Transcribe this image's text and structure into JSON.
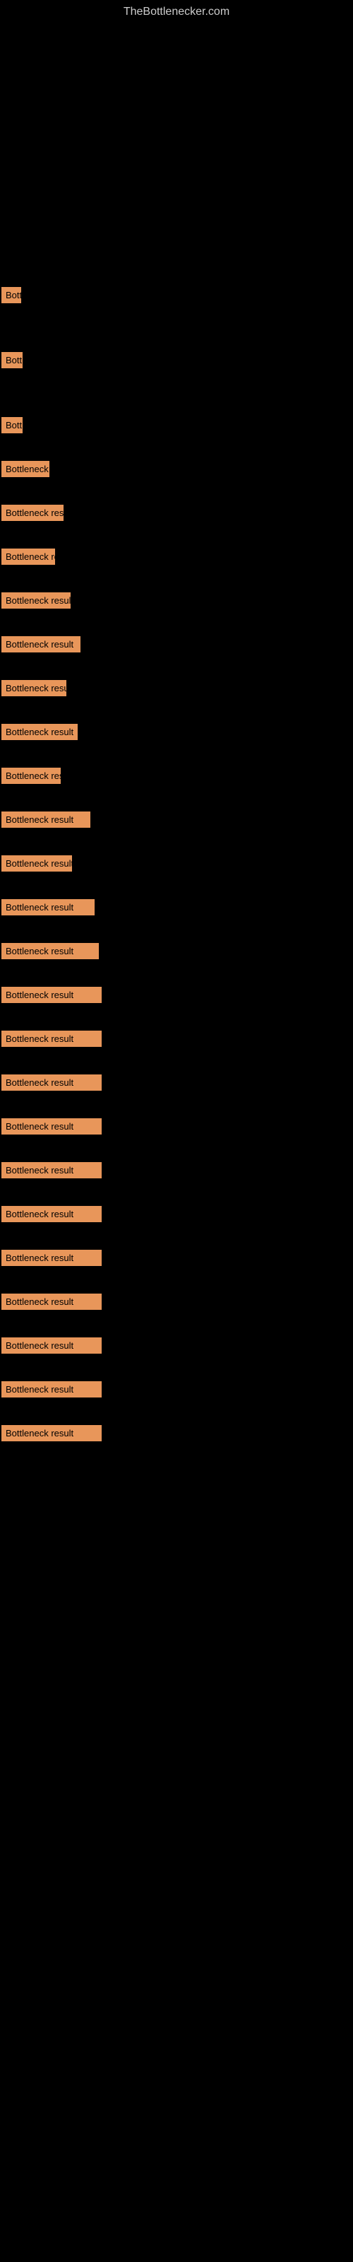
{
  "site": {
    "title": "TheBottlenecker.com"
  },
  "results": [
    {
      "id": 1,
      "label": "Bottleneck result",
      "width_class": "w-tiny",
      "gap_before": 380
    },
    {
      "id": 2,
      "label": "Bottleneck result",
      "width_class": "w-tiny",
      "gap_before": 60
    },
    {
      "id": 3,
      "label": "Bottleneck result",
      "width_class": "w-tiny",
      "gap_before": 60
    },
    {
      "id": 4,
      "label": "Bottleneck result",
      "width_class": "w-small",
      "gap_before": 30
    },
    {
      "id": 5,
      "label": "Bottleneck result",
      "width_class": "w-small",
      "gap_before": 30
    },
    {
      "id": 6,
      "label": "Bottleneck result",
      "width_class": "w-small2",
      "gap_before": 30
    },
    {
      "id": 7,
      "label": "Bottleneck result",
      "width_class": "w-med1",
      "gap_before": 30
    },
    {
      "id": 8,
      "label": "Bottleneck result",
      "width_class": "w-med2",
      "gap_before": 30
    },
    {
      "id": 9,
      "label": "Bottleneck result",
      "width_class": "w-med3",
      "gap_before": 30
    },
    {
      "id": 10,
      "label": "Bottleneck result",
      "width_class": "w-med4",
      "gap_before": 30
    },
    {
      "id": 11,
      "label": "Bottleneck result",
      "width_class": "w-med5",
      "gap_before": 30
    },
    {
      "id": 12,
      "label": "Bottleneck result",
      "width_class": "w-med6",
      "gap_before": 30
    },
    {
      "id": 13,
      "label": "Bottleneck result",
      "width_class": "w-med7",
      "gap_before": 30
    },
    {
      "id": 14,
      "label": "Bottleneck result",
      "width_class": "w-med8",
      "gap_before": 30
    },
    {
      "id": 15,
      "label": "Bottleneck result",
      "width_class": "w-full",
      "gap_before": 30
    },
    {
      "id": 16,
      "label": "Bottleneck result",
      "width_class": "w-full2",
      "gap_before": 30
    },
    {
      "id": 17,
      "label": "Bottleneck result",
      "width_class": "w-full",
      "gap_before": 30
    },
    {
      "id": 18,
      "label": "Bottleneck result",
      "width_class": "w-full",
      "gap_before": 30
    },
    {
      "id": 19,
      "label": "Bottleneck result",
      "width_class": "w-full",
      "gap_before": 30
    },
    {
      "id": 20,
      "label": "Bottleneck result",
      "width_class": "w-full",
      "gap_before": 30
    },
    {
      "id": 21,
      "label": "Bottleneck result",
      "width_class": "w-full",
      "gap_before": 30
    },
    {
      "id": 22,
      "label": "Bottleneck result",
      "width_class": "w-full",
      "gap_before": 30
    },
    {
      "id": 23,
      "label": "Bottleneck result",
      "width_class": "w-full",
      "gap_before": 30
    },
    {
      "id": 24,
      "label": "Bottleneck result",
      "width_class": "w-full",
      "gap_before": 30
    },
    {
      "id": 25,
      "label": "Bottleneck result",
      "width_class": "w-full",
      "gap_before": 30
    },
    {
      "id": 26,
      "label": "Bottleneck result",
      "width_class": "w-full",
      "gap_before": 30
    }
  ]
}
